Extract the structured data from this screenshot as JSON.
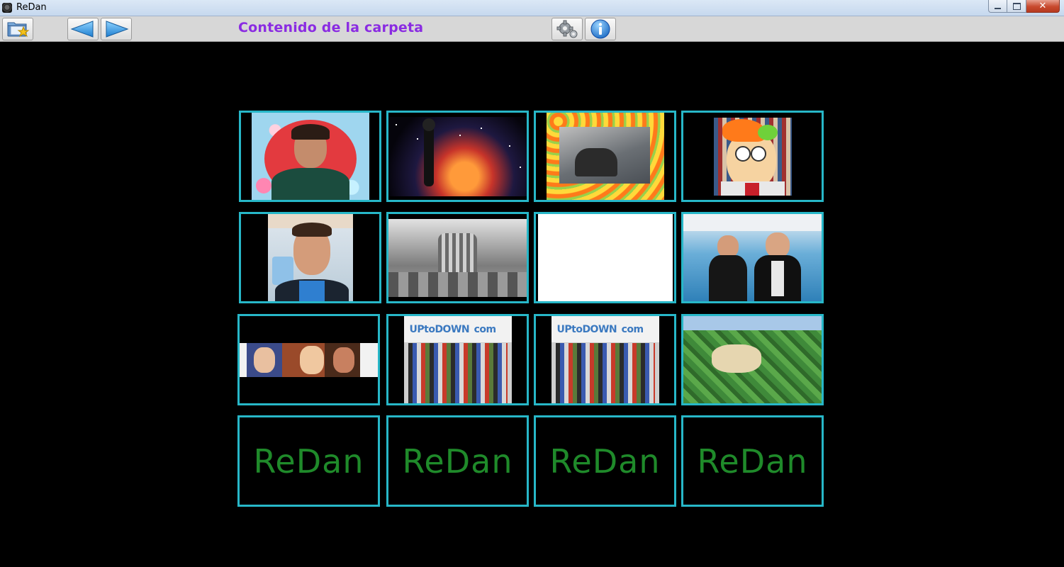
{
  "window": {
    "title": "ReDan",
    "close_glyph": "✕"
  },
  "toolbar": {
    "folder_title": "Contenido de la carpeta",
    "icons": [
      "open-folder-icon",
      "arrow-left-icon",
      "arrow-right-icon",
      "settings-gear-icon",
      "info-icon"
    ]
  },
  "colors": {
    "tile_border": "#27b7c8",
    "placeholder_text": "#1f8a2a",
    "title_text": "#8a2be2",
    "background": "#000000"
  },
  "gallery": {
    "placeholders": [
      "ReDan",
      "ReDan",
      "ReDan",
      "ReDan"
    ],
    "banner_text": [
      "UPtoDOWN",
      "UPtoDOWN"
    ],
    "banner_suffix": [
      "com",
      "com"
    ]
  }
}
